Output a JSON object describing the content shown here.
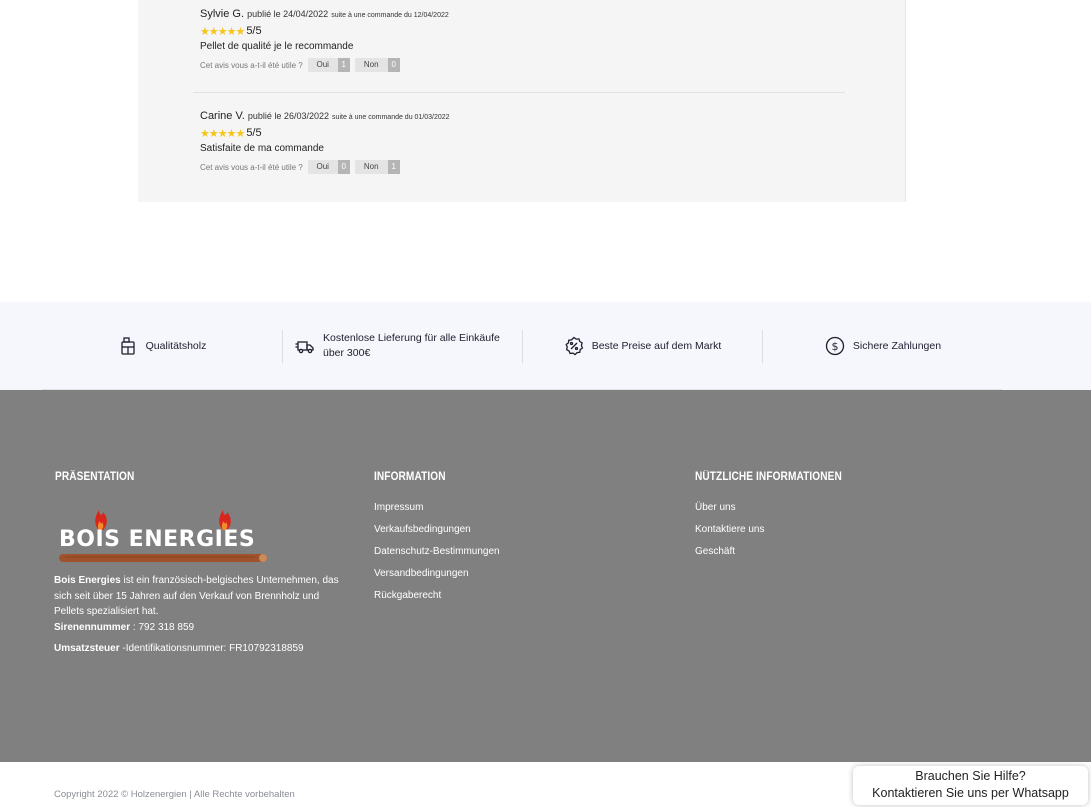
{
  "reviews": [
    {
      "author": "Sylvie G.",
      "published": "publié le 24/04/2022",
      "order": "suite à une commande du 12/04/2022",
      "stars": "★★★★★",
      "score": "5/5",
      "text": "Pellet de qualité je le recommande",
      "helpful_label": "Cet avis vous a-t-il été utile ?",
      "yes_label": "Oui",
      "yes_count": "1",
      "no_label": "Non",
      "no_count": "0"
    },
    {
      "author": "Carine V.",
      "published": "publié le 26/03/2022",
      "order": "suite à une commande du 01/03/2022",
      "stars": "★★★★★",
      "score": "5/5",
      "text": "Satisfaite de ma commande",
      "helpful_label": "Cet avis vous a-t-il été utile ?",
      "yes_label": "Oui",
      "yes_count": "0",
      "no_label": "Non",
      "no_count": "1"
    }
  ],
  "features": [
    {
      "label": "Qualitätsholz",
      "icon": "wood-stack-icon"
    },
    {
      "label": "Kostenlose Lieferung für alle Einkäufe über 300€",
      "icon": "delivery-truck-icon"
    },
    {
      "label": "Beste Preise auf dem Markt",
      "icon": "discount-badge-icon"
    },
    {
      "label": "Sichere Zahlungen",
      "icon": "dollar-coin-icon"
    }
  ],
  "footer": {
    "presentation": {
      "title": "PRÄSENTATION",
      "logo_text": "BOIS ENERGIES",
      "company_name": "Bois Energies",
      "description": " ist ein französisch-belgisches Unternehmen, das sich seit über 15 Jahren auf den Verkauf von Brennholz und Pellets spezialisiert hat.",
      "siren_label": "Sirenennummer",
      "siren_value": " : 792 318 859",
      "vat_label": "Umsatzsteuer",
      "vat_value": " -Identifikationsnummer: FR10792318859"
    },
    "information": {
      "title": "INFORMATION",
      "links": [
        "Impressum",
        "Verkaufsbedingungen",
        "Datenschutz-Bestimmungen",
        "Versandbedingungen",
        "Rückgaberecht"
      ]
    },
    "useful": {
      "title": "NÜTZLICHE INFORMATIONEN",
      "links": [
        "Über uns",
        "Kontaktiere uns",
        "Geschäft"
      ]
    },
    "copyright": "Copyright 2022 © Holzenergien | Alle Rechte vorbehalten"
  },
  "whatsapp": {
    "line1": "Brauchen Sie Hilfe?",
    "line2": "Kontaktieren Sie uns per Whatsapp"
  },
  "colors": {
    "footer_bg": "#808080",
    "features_bg": "#f5f7fc",
    "star": "#f5c518",
    "logo_flame": "#d8261c"
  }
}
